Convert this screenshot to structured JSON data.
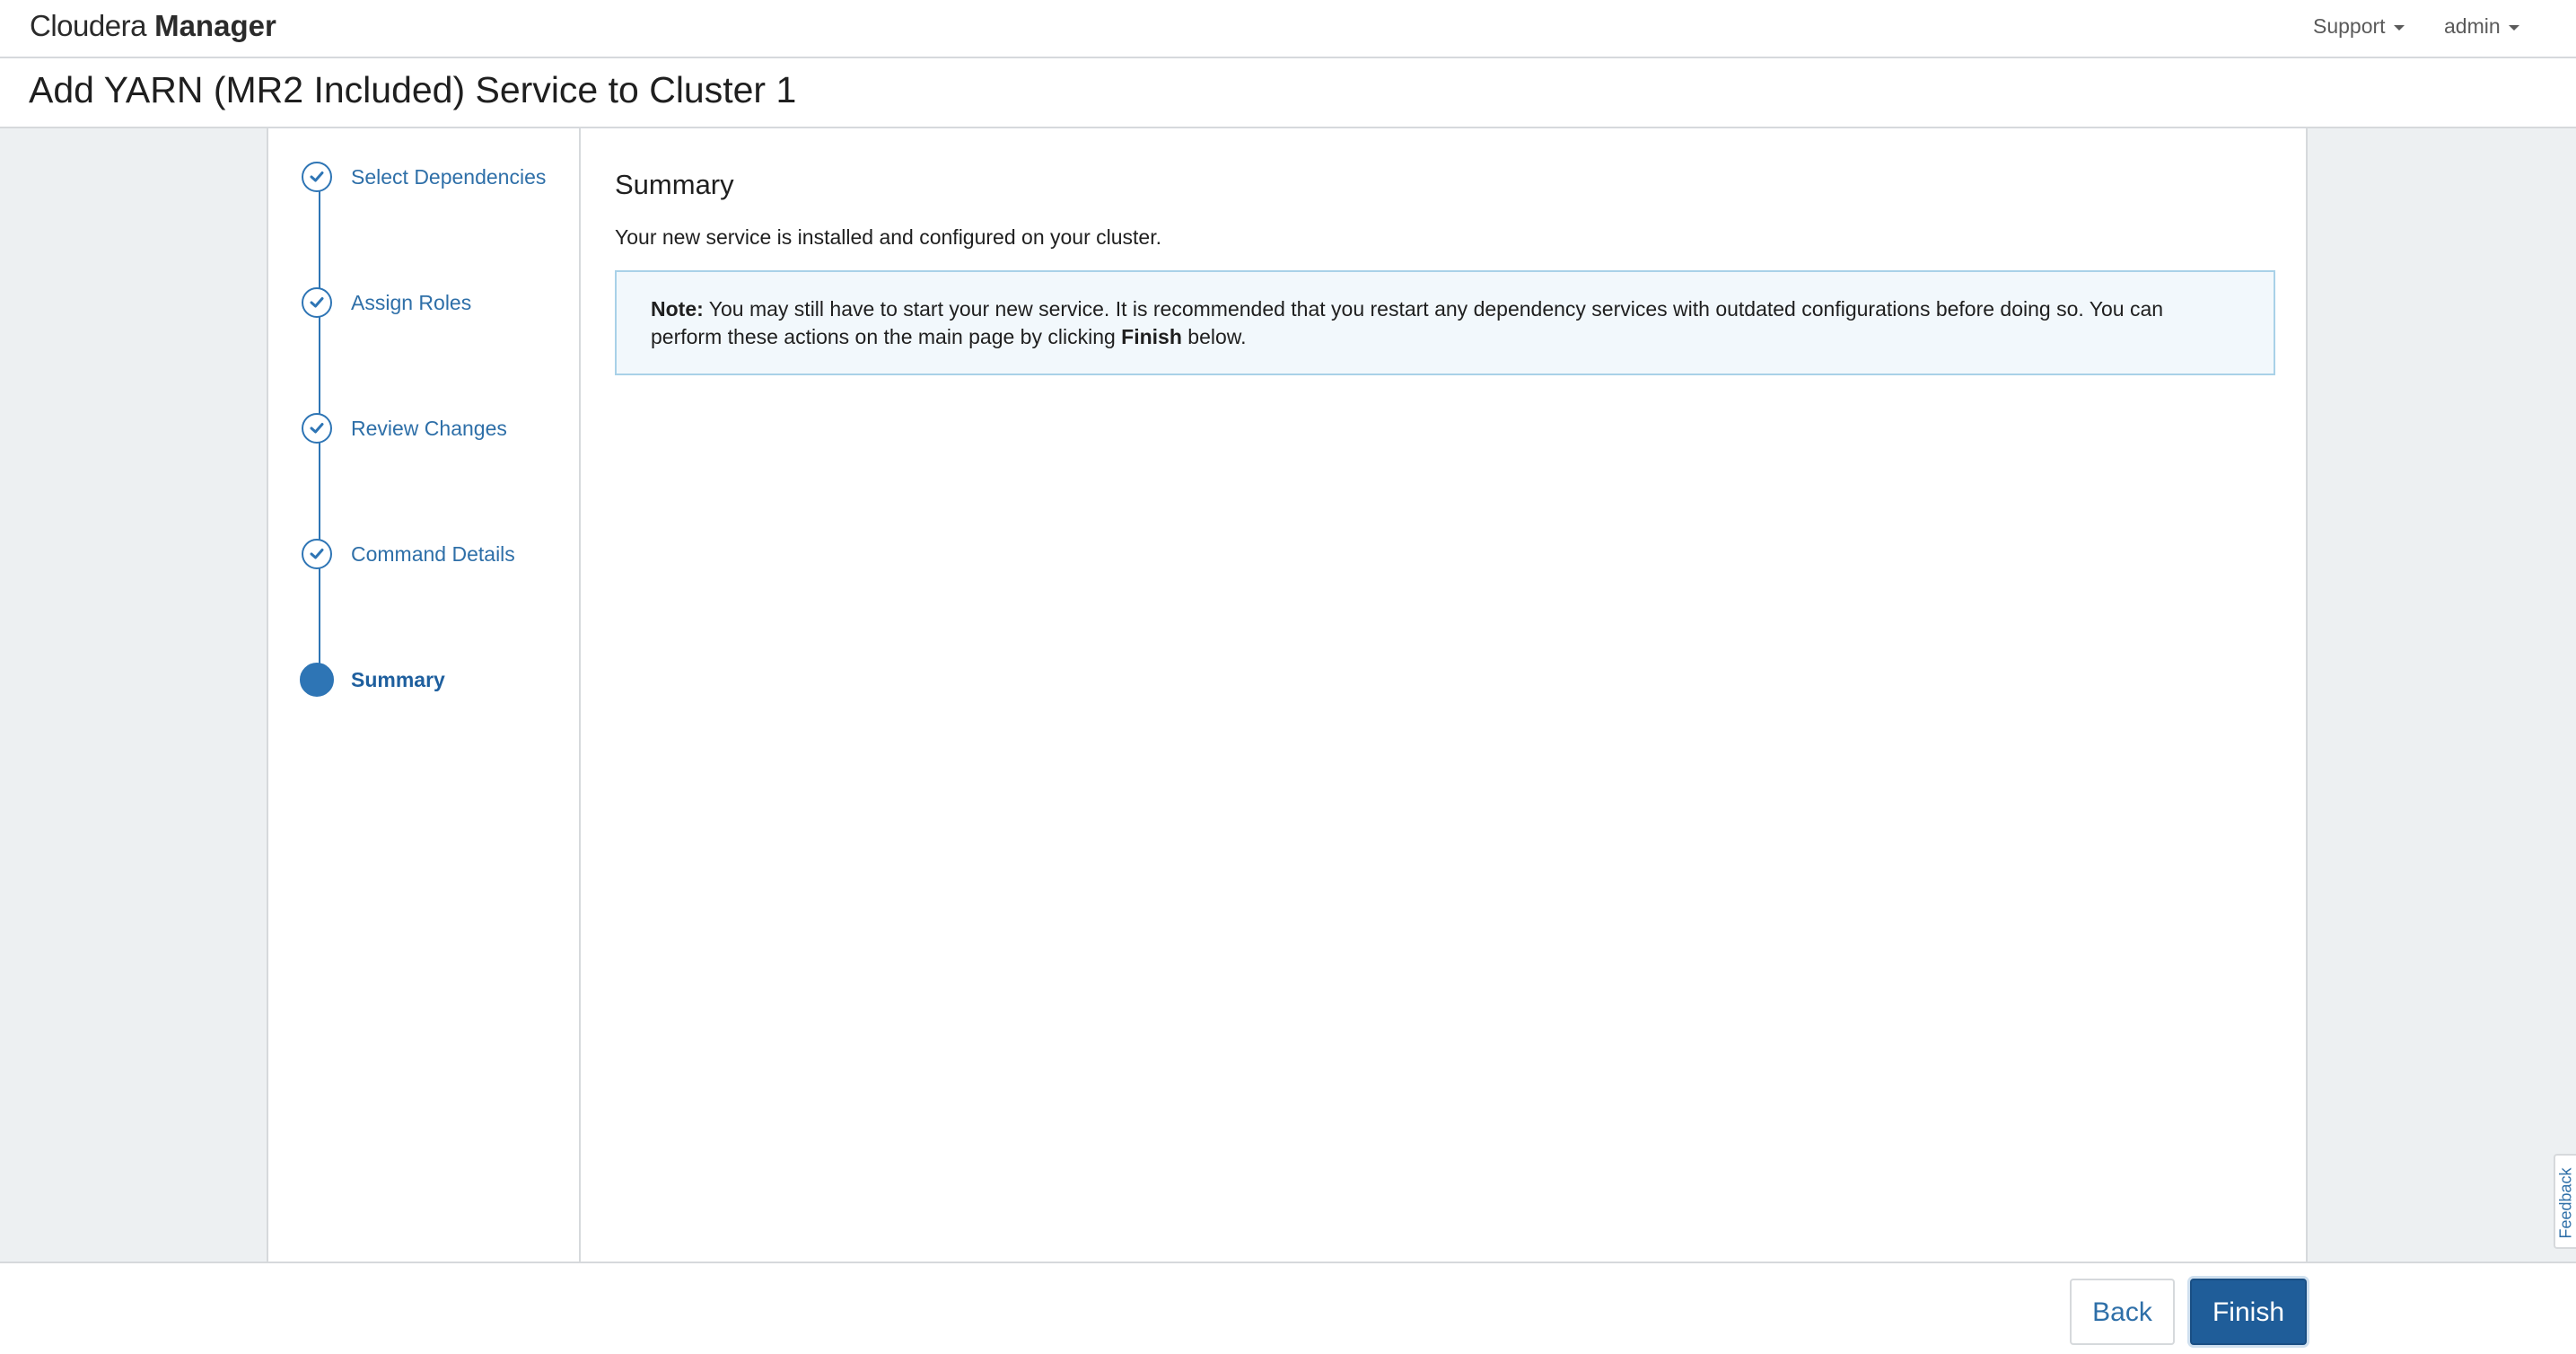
{
  "header": {
    "brand_light": "Cloudera",
    "brand_bold": "Manager",
    "menus": [
      {
        "label": "Support"
      },
      {
        "label": "admin"
      }
    ]
  },
  "page": {
    "title": "Add YARN (MR2 Included) Service to Cluster 1"
  },
  "wizard": {
    "steps": [
      {
        "label": "Select Dependencies",
        "state": "completed"
      },
      {
        "label": "Assign Roles",
        "state": "completed"
      },
      {
        "label": "Review Changes",
        "state": "completed"
      },
      {
        "label": "Command Details",
        "state": "completed"
      },
      {
        "label": "Summary",
        "state": "current"
      }
    ]
  },
  "main": {
    "section_title": "Summary",
    "summary_text": "Your new service is installed and configured on your cluster.",
    "note": {
      "label": "Note:",
      "text_before": " You may still have to start your new service. It is recommended that you restart any dependency services with outdated configurations before doing so. You can perform these actions on the main page by clicking ",
      "emphasis": "Finish",
      "text_after": " below."
    }
  },
  "footer": {
    "back_label": "Back",
    "finish_label": "Finish"
  },
  "feedback": {
    "label": "Feedback"
  },
  "colors": {
    "accent": "#2e75b5",
    "finish_button": "#1f5d99",
    "background": "#edf0f2",
    "note_background": "#f2f8fc",
    "note_border": "#a9d1e8"
  }
}
